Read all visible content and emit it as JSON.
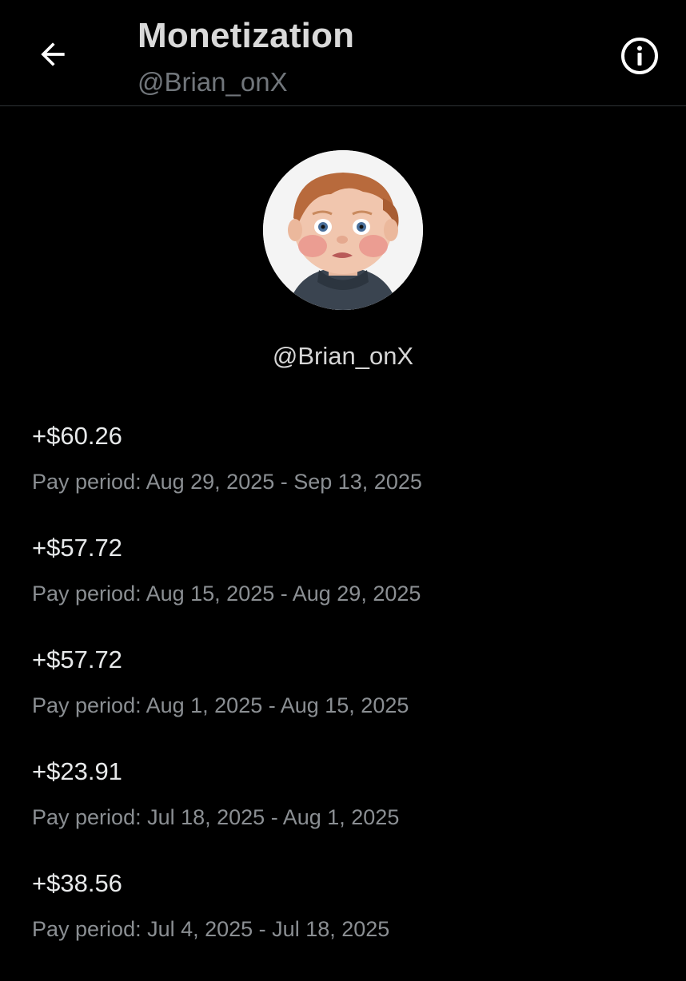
{
  "header": {
    "title": "Monetization",
    "subtitle": "@Brian_onX",
    "back_icon": "arrow-left-icon",
    "info_icon": "info-circle-icon"
  },
  "profile": {
    "handle": "@Brian_onX"
  },
  "payments": [
    {
      "amount": "+$60.26",
      "period": "Pay period: Aug 29, 2025 - Sep 13, 2025"
    },
    {
      "amount": "+$57.72",
      "period": "Pay period: Aug 15, 2025 - Aug 29, 2025"
    },
    {
      "amount": "+$57.72",
      "period": "Pay period: Aug 1, 2025 - Aug 15, 2025"
    },
    {
      "amount": "+$23.91",
      "period": "Pay period: Jul 18, 2025 - Aug 1, 2025"
    },
    {
      "amount": "+$38.56",
      "period": "Pay period: Jul 4, 2025 - Jul 18, 2025"
    }
  ],
  "colors": {
    "background": "#000000",
    "text": "#e7e9ea",
    "secondary_text": "#71767b",
    "divider": "#2f3336"
  }
}
